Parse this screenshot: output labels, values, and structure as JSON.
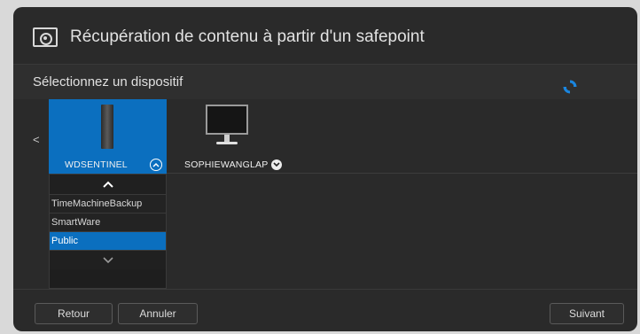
{
  "dialog": {
    "title": "Récupération de contenu à partir d'un safepoint"
  },
  "section": {
    "title": "Sélectionnez un dispositif"
  },
  "devices": [
    {
      "label": "WDSENTINEL",
      "selected": true
    },
    {
      "label": "SOPHIEWANGLAP",
      "selected": false
    }
  ],
  "shares": [
    {
      "label": "TimeMachineBackup",
      "selected": false
    },
    {
      "label": "SmartWare",
      "selected": false
    },
    {
      "label": "Public",
      "selected": true
    }
  ],
  "nav": {
    "left_arrow": "<"
  },
  "buttons": {
    "back": "Retour",
    "cancel": "Annuler",
    "next": "Suivant"
  },
  "colors": {
    "accent": "#0b6fbf",
    "background": "#2a2a2a"
  }
}
